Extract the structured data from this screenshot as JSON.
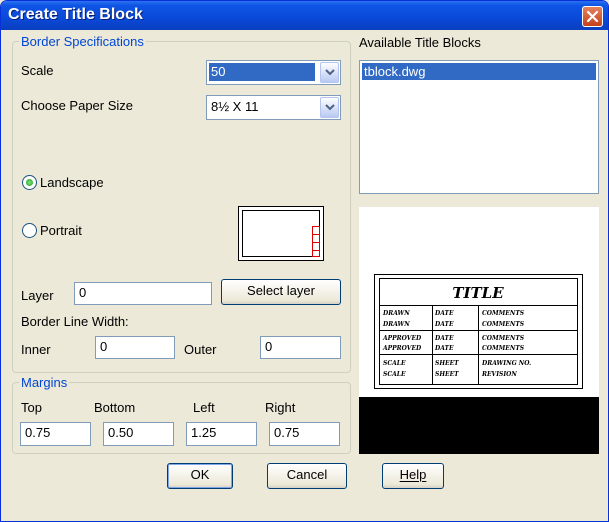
{
  "window": {
    "title": "Create Title Block"
  },
  "border_specs": {
    "legend": "Border Specifications",
    "scale_label": "Scale",
    "scale_value": "50",
    "paper_label": "Choose Paper Size",
    "paper_value": "8½ X 11",
    "landscape_label": "Landscape",
    "portrait_label": "Portrait",
    "orientation_selected": "Landscape",
    "layer_label": "Layer",
    "layer_value": "0",
    "select_layer_label": "Select layer",
    "border_line_width_label": "Border Line Width:",
    "inner_label": "Inner",
    "inner_value": "0",
    "outer_label": "Outer",
    "outer_value": "0"
  },
  "margins": {
    "legend": "Margins",
    "top_label": "Top",
    "top_value": "0.75",
    "bottom_label": "Bottom",
    "bottom_value": "0.50",
    "left_label": "Left",
    "left_value": "1.25",
    "right_label": "Right",
    "right_value": "0.75"
  },
  "title_blocks": {
    "label": "Available Title Blocks",
    "items": [
      "tblock.dwg"
    ],
    "preview_title": "TITLE",
    "preview_rows": [
      [
        "DRAWN",
        "DATE",
        "COMMENTS"
      ],
      [
        "DRAWN",
        "DATE",
        "COMMENTS"
      ],
      [
        "APPROVED",
        "DATE",
        "COMMENTS"
      ],
      [
        "APPROVED",
        "DATE",
        "COMMENTS"
      ],
      [
        "SCALE",
        "SHEET",
        "DRAWING NO."
      ],
      [
        "SCALE",
        "SHEET",
        "REVISION"
      ]
    ]
  },
  "buttons": {
    "ok": "OK",
    "cancel": "Cancel",
    "help": "Help"
  },
  "colors": {
    "titlebar": "#0a49d8",
    "legend": "#0046d5",
    "selection": "#316ac5",
    "preview_red": "#e00000"
  }
}
